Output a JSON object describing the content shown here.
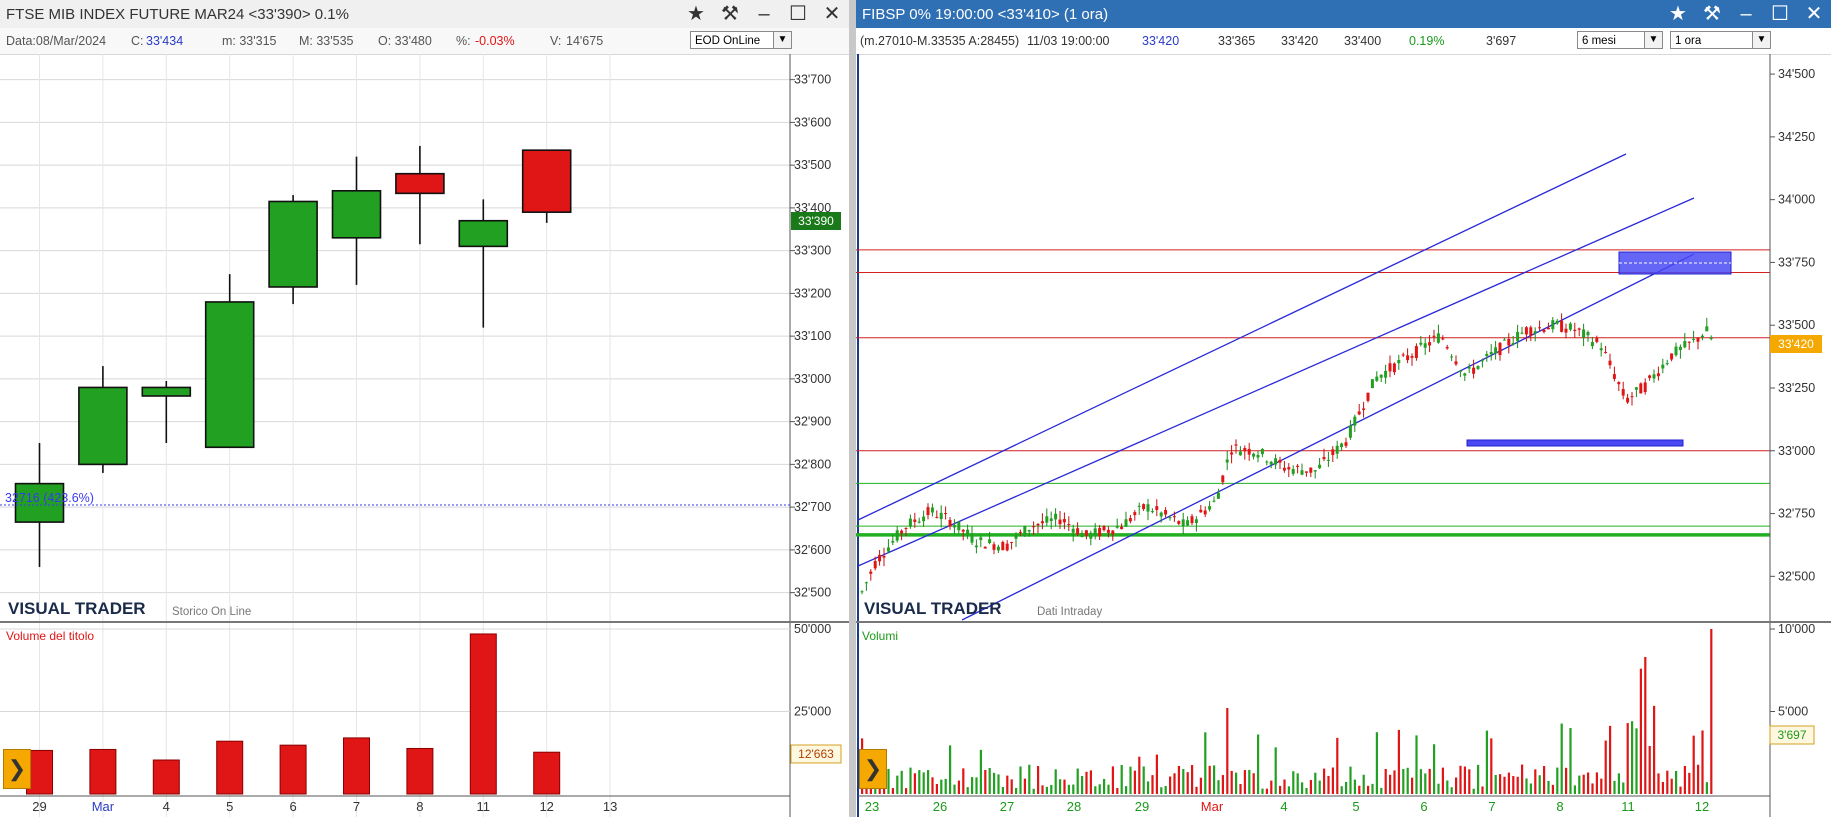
{
  "left": {
    "title": "FTSE MIB INDEX FUTURE MAR24 <33'390> 0.1%",
    "info": {
      "date": "Data:08/Mar/2024",
      "close_label": "C:",
      "close_value": "33'434",
      "min": "m: 33'315",
      "max": "M: 33'535",
      "open": "O: 33'480",
      "pct_label": "%:",
      "pct_value": "-0.03%",
      "vol_label": "V:",
      "vol_value": "14'675"
    },
    "mode_select": "EOD OnLine",
    "y_ticks": [
      "33'700",
      "33'600",
      "33'500",
      "33'400",
      "33'300",
      "33'200",
      "33'100",
      "33'000",
      "32'900",
      "32'800",
      "32'700",
      "32'600",
      "32'500"
    ],
    "price_label": "33'390",
    "annotation": "32716 (423.6%)",
    "brand": "VISUAL TRADER",
    "brand_sub": "Storico On Line",
    "volume_title": "Volume del titolo",
    "vol_ticks": [
      "50'000",
      "25'000"
    ],
    "vol_label_current": "12'663",
    "x_labels": [
      "29",
      "Mar",
      "4",
      "5",
      "6",
      "7",
      "8",
      "11",
      "12",
      "13"
    ]
  },
  "right": {
    "title": "FIBSP 0% 19:00:00 <33'410> (1 ora)",
    "info": {
      "range": "(m.27010-M.33535 A:28455)",
      "datetime": "11/03 19:00:00",
      "last": "33'420",
      "v1": "33'365",
      "v2": "33'420",
      "v3": "33'400",
      "pct": "0.19%",
      "vol": "3'697"
    },
    "period_select": "6 mesi",
    "interval_select": "1 ora",
    "y_ticks": [
      "34'500",
      "34'250",
      "34'000",
      "33'750",
      "33'500",
      "33'250",
      "33'000",
      "32'750",
      "32'500"
    ],
    "price_label": "33'420",
    "brand": "VISUAL TRADER",
    "brand_sub": "Dati Intraday",
    "volume_title": "Volumi",
    "vol_ticks": [
      "10'000",
      "5'000"
    ],
    "vol_label_current": "3'697",
    "x_labels": [
      "23",
      "26",
      "27",
      "28",
      "29",
      "Mar",
      "4",
      "5",
      "6",
      "7",
      "8",
      "11",
      "12"
    ]
  },
  "icons": [
    "star-icon",
    "hammer-icon",
    "minimize-icon",
    "maximize-icon",
    "close-icon",
    "expand-arrow-icon"
  ],
  "colors": {
    "up": "#22a022",
    "down": "#e01515",
    "axis": "#555555",
    "accent_blue": "#3a3af0",
    "title_blue": "#2f6fb4"
  },
  "chart_data": [
    {
      "type": "candlestick",
      "name": "FTSE MIB INDEX FUTURE MAR24 daily",
      "x": [
        "29",
        "Mar",
        "4",
        "5",
        "6",
        "7",
        "8",
        "11",
        "12"
      ],
      "open": [
        32665,
        32800,
        32960,
        32840,
        33215,
        33330,
        33480,
        33310,
        33535
      ],
      "high": [
        32850,
        33030,
        32995,
        33245,
        33430,
        33520,
        33545,
        33420,
        33535
      ],
      "low": [
        32560,
        32780,
        32850,
        32840,
        33175,
        33220,
        33315,
        33120,
        33365
      ],
      "close": [
        32755,
        32980,
        32980,
        33180,
        33415,
        33440,
        33434,
        33370,
        33390
      ],
      "volume": [
        13200,
        13500,
        10300,
        16000,
        14800,
        17000,
        13800,
        48500,
        12663
      ],
      "ylim": [
        32450,
        33760
      ],
      "vol_ylim": [
        0,
        50000
      ]
    },
    {
      "type": "candlestick-hourly",
      "name": "FIBSP 1 ora",
      "x": [
        "23",
        "26",
        "27",
        "28",
        "29",
        "Mar",
        "4",
        "5",
        "6",
        "7",
        "8",
        "11",
        "12"
      ],
      "ylim": [
        32350,
        34580
      ],
      "horizontal_lines": [
        33800,
        33710,
        33450,
        33000,
        32870,
        32700,
        32665
      ],
      "last_price": 33420,
      "vol_ylim": [
        0,
        10000
      ]
    }
  ]
}
